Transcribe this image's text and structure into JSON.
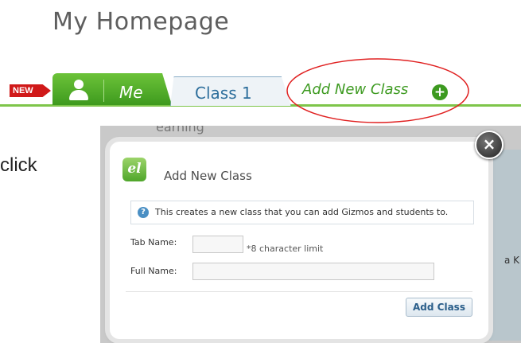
{
  "page": {
    "title": "My Homepage"
  },
  "tabs": {
    "new_badge": "NEW",
    "me_label": "Me",
    "class1_label": "Class 1",
    "add_new_class_label": "Add New Class"
  },
  "instruction": {
    "click_text": "click"
  },
  "background_page": {
    "partial_header": "earning",
    "partial_side_text": "a K"
  },
  "modal": {
    "logo_text": "el",
    "title": "Add New Class",
    "info_text": "This creates a new class that you can add Gizmos and students to.",
    "tab_name_label": "Tab Name:",
    "tab_name_value": "",
    "char_limit_note": "*8 character limit",
    "full_name_label": "Full Name:",
    "full_name_value": "",
    "submit_label": "Add Class",
    "close_symbol": "×"
  },
  "colors": {
    "accent_green": "#3d9a20",
    "tab_blue": "#2e6f9c",
    "highlight_red": "#e02020",
    "new_badge_red": "#d01919"
  }
}
